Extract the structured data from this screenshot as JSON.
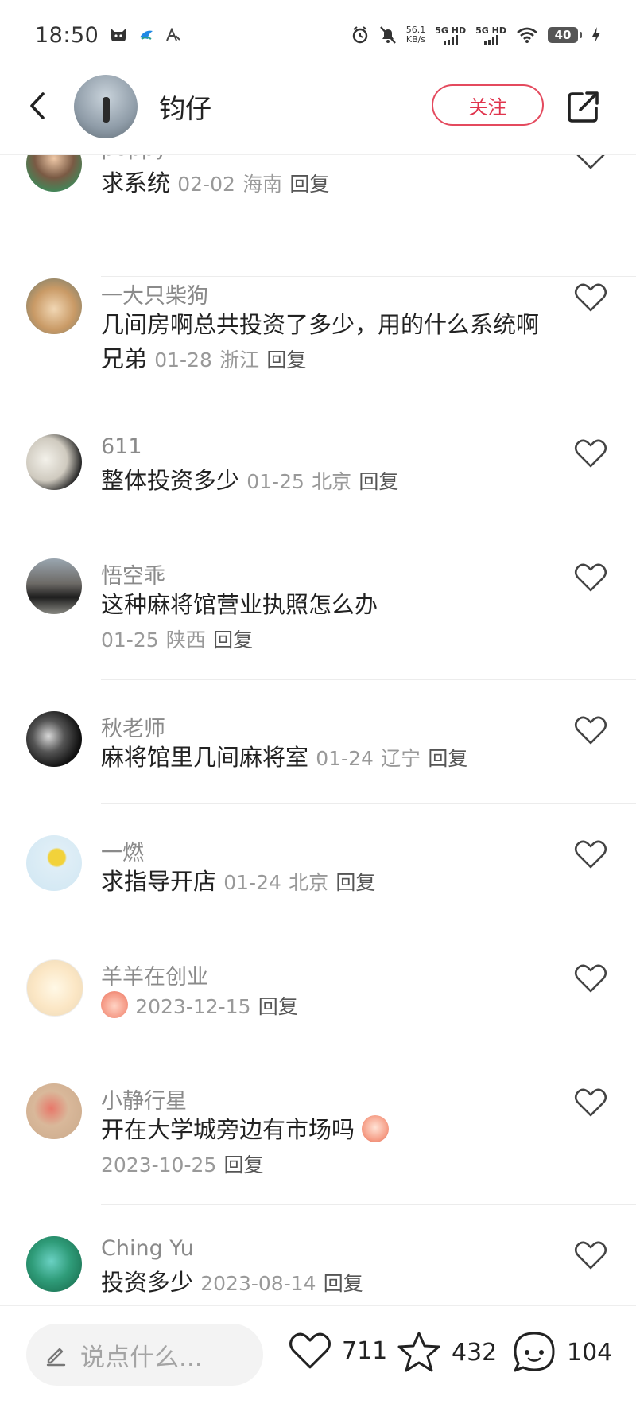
{
  "status_bar": {
    "time": "18:50",
    "speed_value": "56.1",
    "speed_unit": "KB/s",
    "net1": "5G HD",
    "net2": "5G HD",
    "battery": "40"
  },
  "header": {
    "name": "钧仔",
    "follow_label": "关注"
  },
  "comments": [
    {
      "user": "poppy",
      "text": "求系统",
      "date": "02-02",
      "region": "海南",
      "reply": "回复"
    },
    {
      "user": "一大只柴狗",
      "text": "几间房啊总共投资了多少，用的什么系统啊兄弟",
      "date": "01-28",
      "region": "浙江",
      "reply": "回复"
    },
    {
      "user": "611",
      "text": "整体投资多少",
      "date": "01-25",
      "region": "北京",
      "reply": "回复"
    },
    {
      "user": "悟空乖",
      "text": "这种麻将馆营业执照怎么办",
      "date": "01-25",
      "region": "陕西",
      "reply": "回复"
    },
    {
      "user": "秋老师",
      "text": "麻将馆里几间麻将室",
      "date": "01-24",
      "region": "辽宁",
      "reply": "回复"
    },
    {
      "user": "一燃",
      "text": "求指导开店",
      "date": "01-24",
      "region": "北京",
      "reply": "回复"
    },
    {
      "user": "羊羊在创业",
      "text": "",
      "date": "2023-12-15",
      "region": "",
      "reply": "回复"
    },
    {
      "user": "小静行星",
      "text": "开在大学城旁边有市场吗",
      "date": "2023-10-25",
      "region": "",
      "reply": "回复"
    },
    {
      "user": "Ching Yu",
      "text": "投资多少",
      "date": "2023-08-14",
      "region": "",
      "reply": "回复"
    }
  ],
  "bottom_bar": {
    "input_placeholder": "说点什么...",
    "likes": "711",
    "favorites": "432",
    "comments": "104"
  },
  "colors": {
    "accent": "#e0344d",
    "text": "#222222",
    "muted": "#999999"
  }
}
